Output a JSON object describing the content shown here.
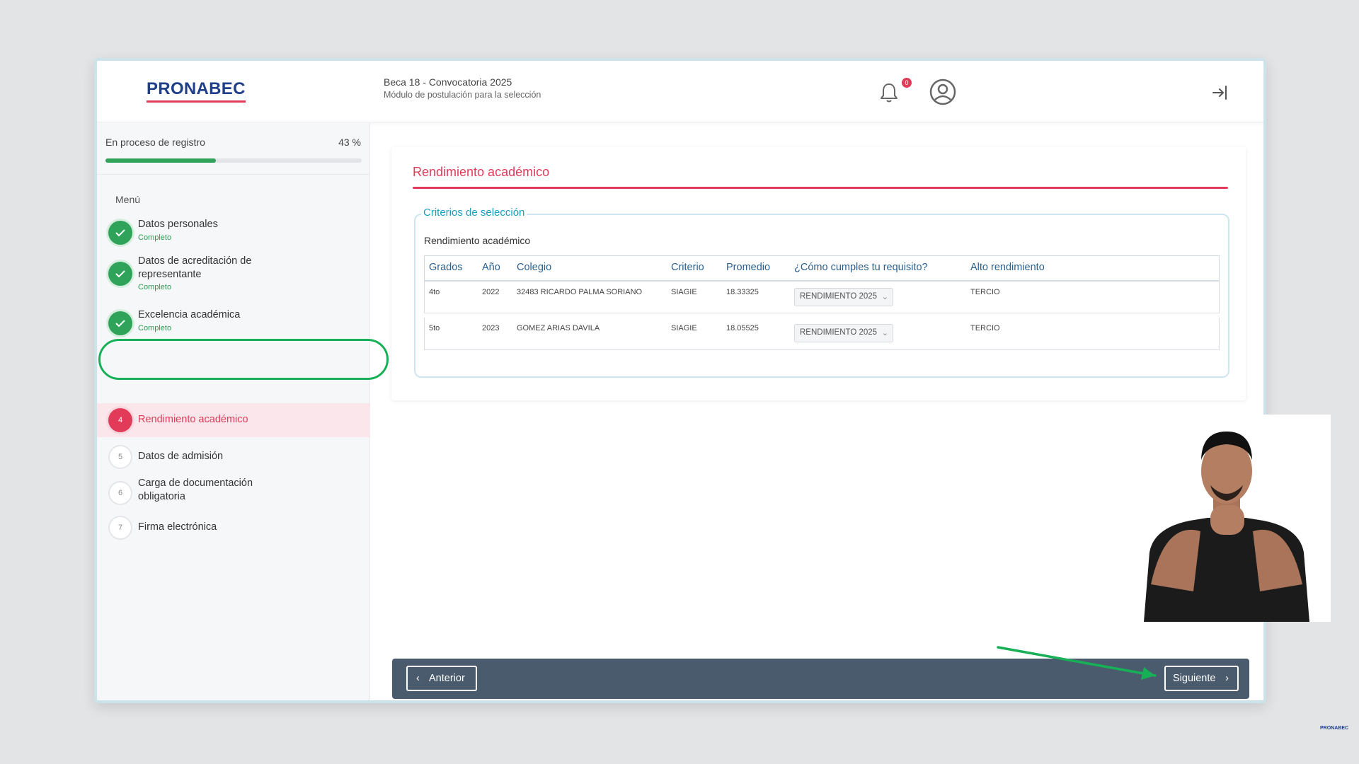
{
  "header": {
    "logo": "PRONABEC",
    "title": "Beca 18 - Convocatoria 2025",
    "subtitle": "Módulo de postulación para la selección",
    "notification_count": "0",
    "icons": [
      "bell-icon",
      "user-avatar-icon",
      "logout-icon"
    ]
  },
  "sidebar": {
    "progress_label": "En proceso de registro",
    "progress_pct": "43 %",
    "progress_value": 0.43,
    "menu_label": "Menú",
    "steps": [
      {
        "title": "Datos personales",
        "status": "Completo",
        "state": "done"
      },
      {
        "title": "Datos de acreditación de representante",
        "status": "Completo",
        "state": "done"
      },
      {
        "title": "Excelencia académica",
        "status": "Completo",
        "state": "done"
      },
      {
        "number": "4",
        "title": "Rendimiento académico",
        "state": "active"
      },
      {
        "number": "5",
        "title": "Datos de admisión",
        "state": "pending"
      },
      {
        "number": "6",
        "title": "Carga de documentación obligatoria",
        "state": "pending"
      },
      {
        "number": "7",
        "title": "Firma electrónica",
        "state": "pending"
      }
    ]
  },
  "main": {
    "section_title": "Rendimiento académico",
    "fieldset_legend": "Criterios de selección",
    "fieldset_subtitle": "Rendimiento académico",
    "table": {
      "headers": [
        "Grados",
        "Año",
        "Colegio",
        "Criterio",
        "Promedio",
        "¿Cómo cumples tu requisito?",
        "Alto rendimiento"
      ],
      "rows": [
        {
          "grado": "4to",
          "anio": "2022",
          "colegio": "32483 RICARDO PALMA SORIANO",
          "criterio": "SIAGIE",
          "promedio": "18.33325",
          "requisito": "RENDIMIENTO 2025",
          "alto": "TERCIO"
        },
        {
          "grado": "5to",
          "anio": "2023",
          "colegio": "GOMEZ ARIAS DAVILA",
          "criterio": "SIAGIE",
          "promedio": "18.05525",
          "requisito": "RENDIMIENTO 2025",
          "alto": "TERCIO"
        }
      ]
    }
  },
  "footer": {
    "prev_label": "Anterior",
    "next_label": "Siguiente"
  },
  "overlay": {
    "corner_logo": "PRONABEC"
  },
  "colors": {
    "accent": "#e23b5a",
    "success": "#2fa35a",
    "table_header": "#2b5f8e",
    "legend": "#1a9ec0",
    "footer": "#4a5b6e",
    "annotation": "#18b057"
  }
}
